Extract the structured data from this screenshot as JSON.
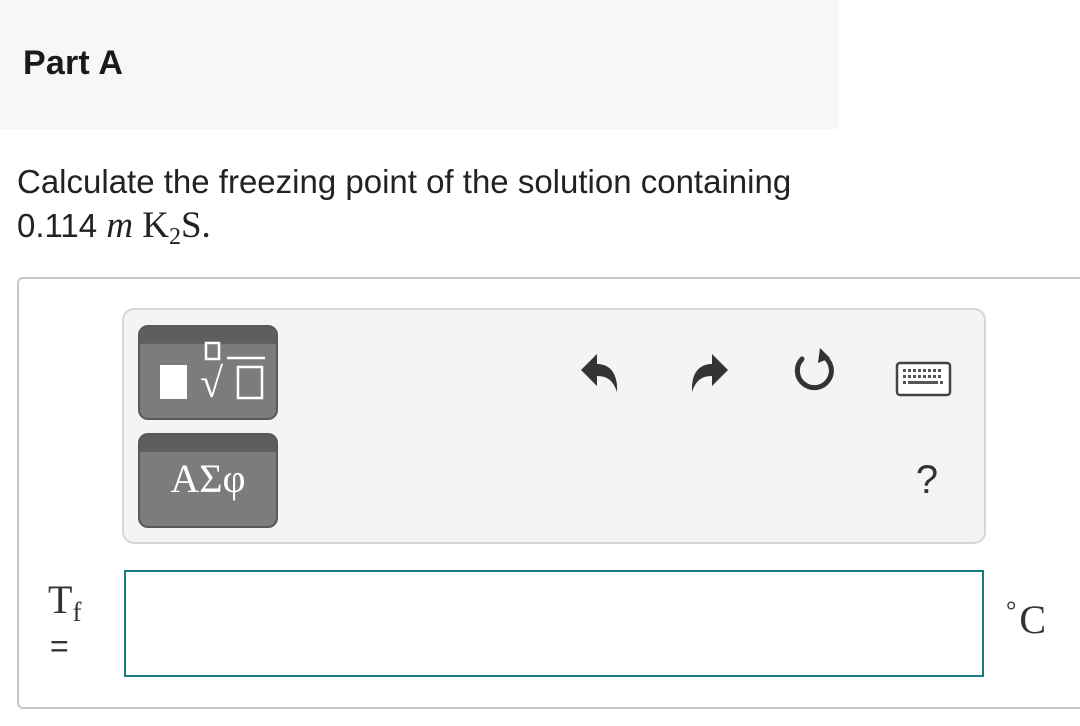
{
  "part": {
    "title": "Part A"
  },
  "question": {
    "text_before": "Calculate the freezing point of the solution containing 0.114 ",
    "molality_symbol": "m",
    "formula_element": "K",
    "formula_subscript": "2",
    "formula_rest": "S",
    "text_after": "."
  },
  "toolbar": {
    "templates_icon": "fraction-radical-template-icon",
    "greek_label": "ΑΣφ",
    "undo_icon": "undo-icon",
    "redo_icon": "redo-icon",
    "reset_icon": "reset-icon",
    "keyboard_icon": "keyboard-icon",
    "help_label": "?"
  },
  "answer": {
    "variable_main": "T",
    "variable_subscript": "f",
    "equals": "=",
    "value": "",
    "unit_degree": "°",
    "unit_symbol": "C"
  },
  "colors": {
    "header_bg": "#f7f7f7",
    "toolbar_bg": "#f4f4f4",
    "button_gray": "#7c7c7c",
    "input_border": "#177b80"
  }
}
